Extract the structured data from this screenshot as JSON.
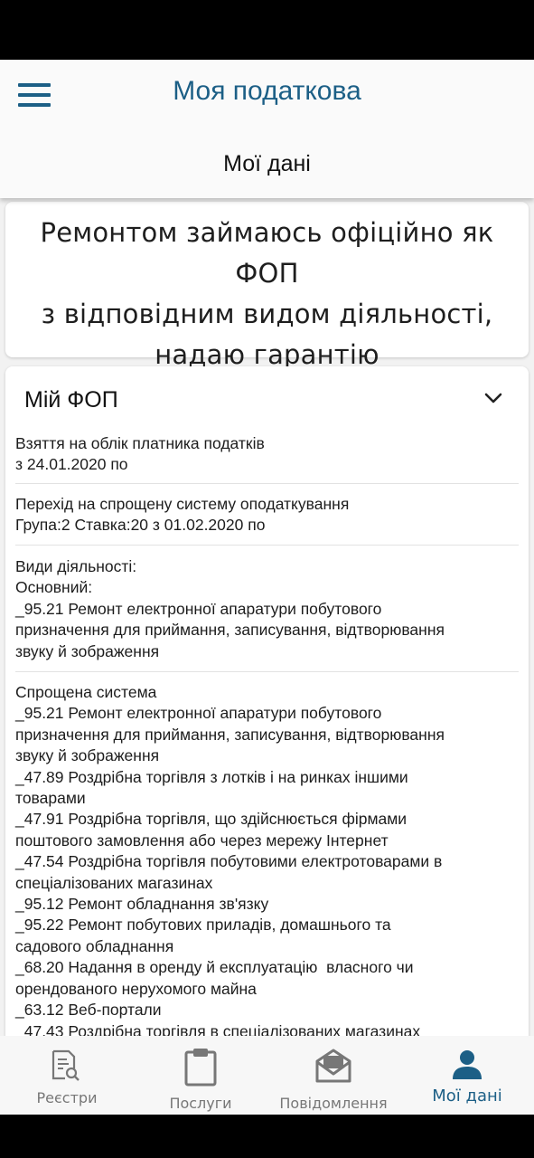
{
  "header": {
    "app_title": "Моя податкова",
    "page_title": "Мої дані"
  },
  "banner": {
    "text": "Ремонтом займаюсь офіційно як ФОП\nз відповідним видом діяльності,\nнадаю гарантію"
  },
  "fop_card": {
    "title": "Мій ФОП",
    "sections": [
      "Взяття на облік платника податків\nз 24.01.2020 по",
      "Перехід на спрощену систему оподаткування\nГрупа:2 Ставка:20 з 01.02.2020 по",
      "Види діяльності:\nОсновний:\n_95.21 Ремонт електронної апаратури побутового\nпризначення для приймання, записування, відтворювання\nзвуку й зображення",
      "Спрощена система\n_95.21 Ремонт електронної апаратури побутового\nпризначення для приймання, записування, відтворювання\nзвуку й зображення\n_47.89 Роздрібна торгівля з лотків і на ринках іншими\nтоварами\n_47.91 Роздрібна торгівля, що здійснюється фірмами\nпоштового замовлення або через мережу Інтернет\n_47.54 Роздрібна торгівля побутовими електротоварами в\nспеціалізованих магазинах\n_95.12 Ремонт обладнання зв'язку\n_95.22 Ремонт побутових приладів, домашнього та\nсадового обладнання\n_68.20 Надання в оренду й експлуатацію  власного чи\nорендованого нерухомого майна\n_63.12 Веб-портали\n_47.43 Роздрібна торгівля в спеціалізованих магазинах"
    ]
  },
  "bottom_nav": {
    "items": [
      {
        "label": "Реєстри",
        "icon": "registry-search-icon"
      },
      {
        "label": "Послуги",
        "icon": "clipboard-icon"
      },
      {
        "label": "Повідомлення",
        "icon": "envelope-icon"
      },
      {
        "label": "Мої дані",
        "icon": "user-icon",
        "active": true
      }
    ]
  },
  "colors": {
    "accent": "#1c5f86",
    "inactive": "#777777",
    "background": "#f2f2f2"
  }
}
